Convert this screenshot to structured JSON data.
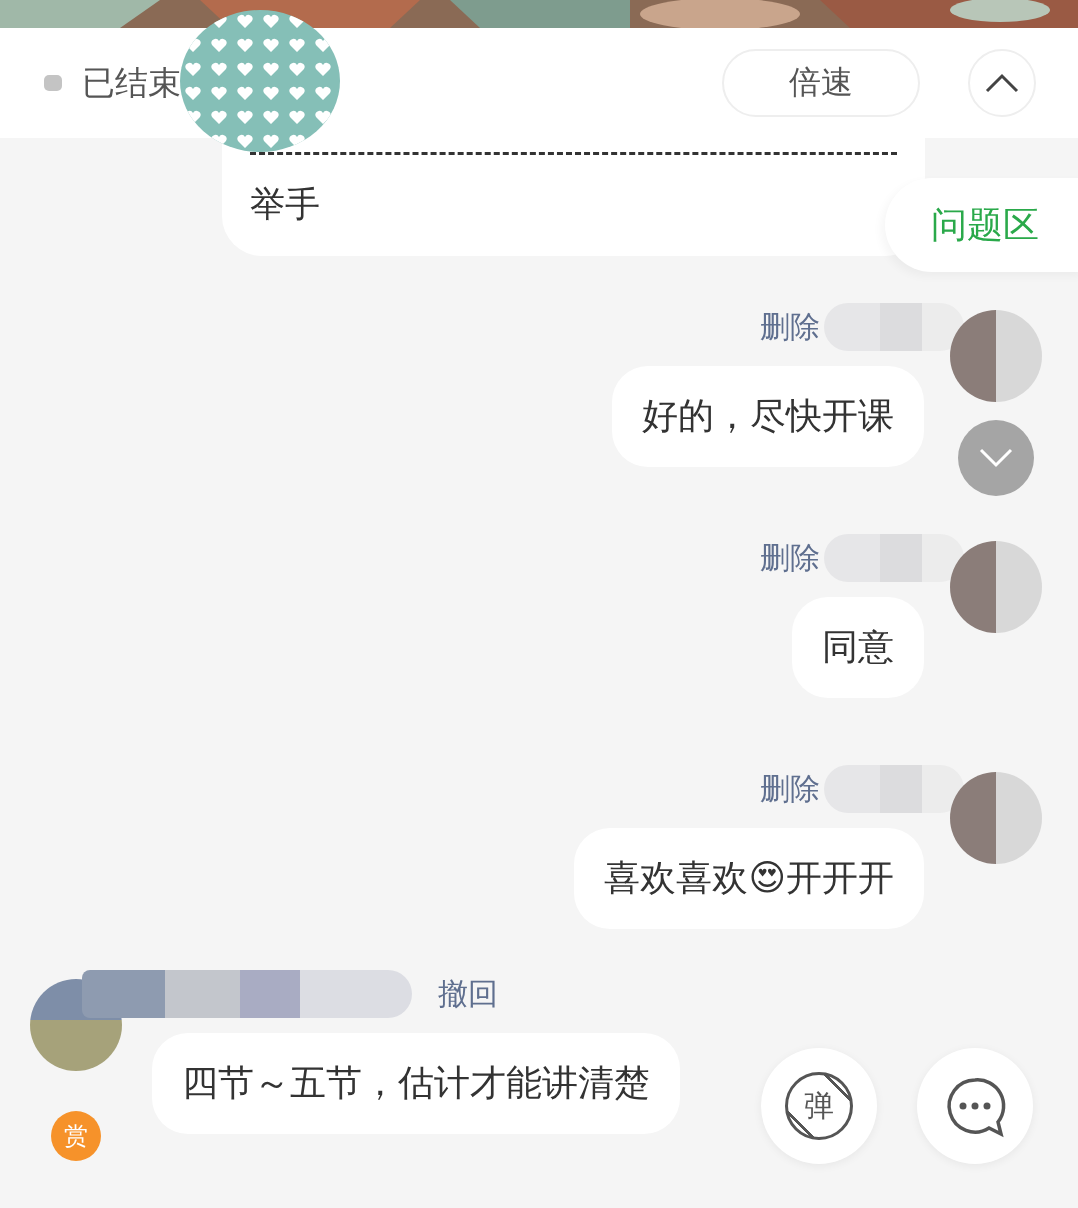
{
  "header": {
    "status": "已结束",
    "speed_button": "倍速"
  },
  "side_tab": "问题区",
  "top_bubble": {
    "text": "举手"
  },
  "messages": [
    {
      "kind": "outgoing",
      "action": "删除",
      "text": "好的，尽快开课"
    },
    {
      "kind": "outgoing",
      "action": "删除",
      "text": "同意"
    },
    {
      "kind": "outgoing",
      "action": "删除",
      "text": "喜欢喜欢😍开开开"
    },
    {
      "kind": "incoming",
      "action": "撤回",
      "text": "四节～五节，估计才能讲清楚",
      "badge": "赏"
    }
  ],
  "float_buttons": {
    "danmaku": "弹"
  }
}
